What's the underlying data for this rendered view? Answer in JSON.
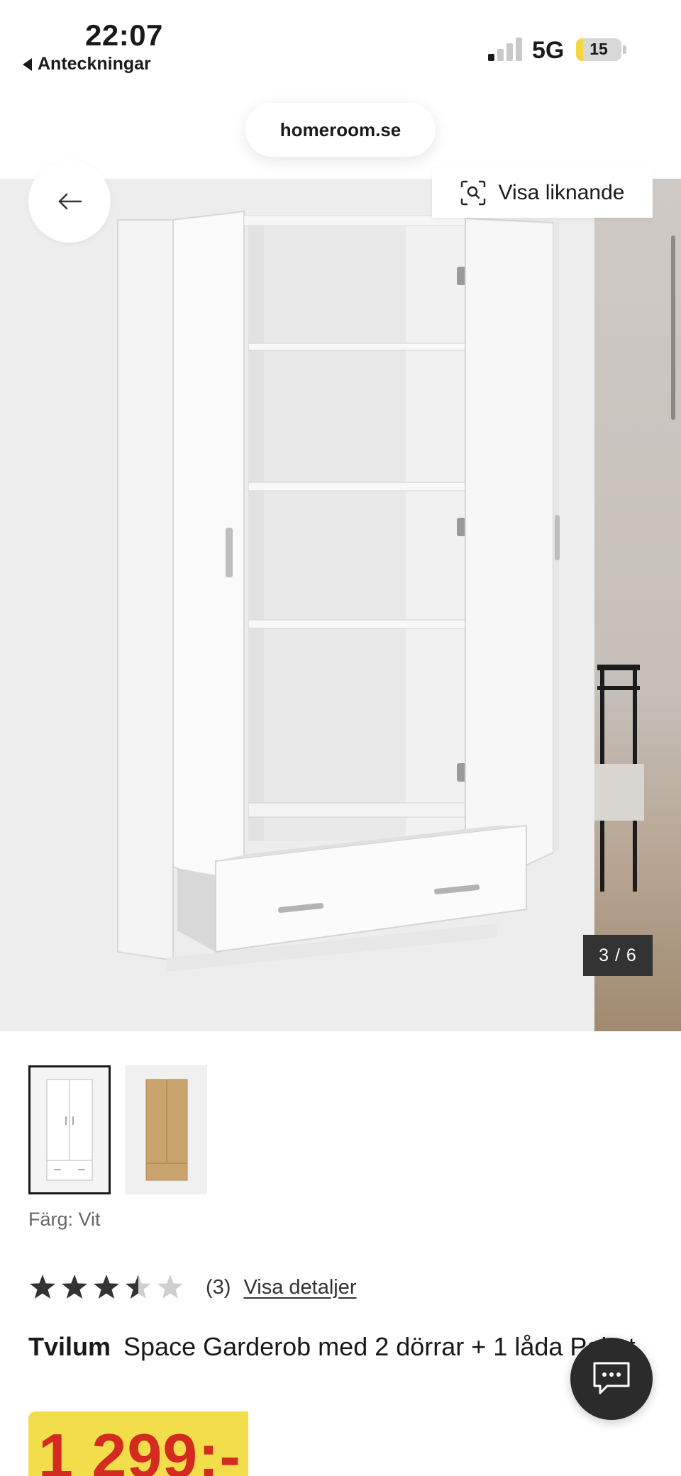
{
  "status_bar": {
    "time": "22:07",
    "back_app": "Anteckningar",
    "network": "5G",
    "battery": "15",
    "battery_level": 0.15
  },
  "browser": {
    "url": "homeroom.se"
  },
  "gallery": {
    "similar_label": "Visa liknande",
    "counter": "3 / 6"
  },
  "product": {
    "color_label": "Färg: Vit",
    "rating": 3.5,
    "review_count": "(3)",
    "details_link": "Visa detaljer",
    "brand": "Tvilum",
    "name": "Space Garderob med 2 dörrar + 1 låda Paket",
    "price": "1 299:-"
  },
  "colors": {
    "price_badge": "#f2dd4b",
    "price_text": "#d42a1f",
    "counter_bg": "#333333",
    "chat_bg": "#2b2b2b"
  },
  "icons": {
    "back": "arrow-left-icon",
    "similar": "visual-search-icon",
    "chat": "chat-icon",
    "star": "star-icon"
  }
}
